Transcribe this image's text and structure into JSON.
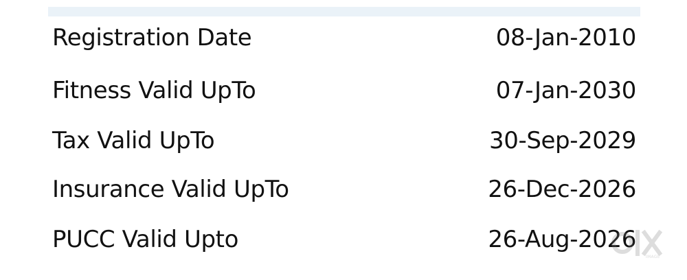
{
  "details": {
    "rows": [
      {
        "label": "Registration Date",
        "value": "08-Jan-2010"
      },
      {
        "label": "Fitness Valid UpTo",
        "value": "07-Jan-2030"
      },
      {
        "label": "Tax Valid UpTo",
        "value": "30-Sep-2029"
      },
      {
        "label": "Insurance Valid UpTo",
        "value": "26-Dec-2026"
      },
      {
        "label": "PUCC Valid Upto",
        "value": "26-Aug-2026"
      }
    ]
  },
  "watermark": {
    "logo_text": "olx",
    "caption": "IMAGE"
  },
  "colors": {
    "top_bar": "#eaf2f8",
    "text": "#111111",
    "watermark": "#777777"
  }
}
